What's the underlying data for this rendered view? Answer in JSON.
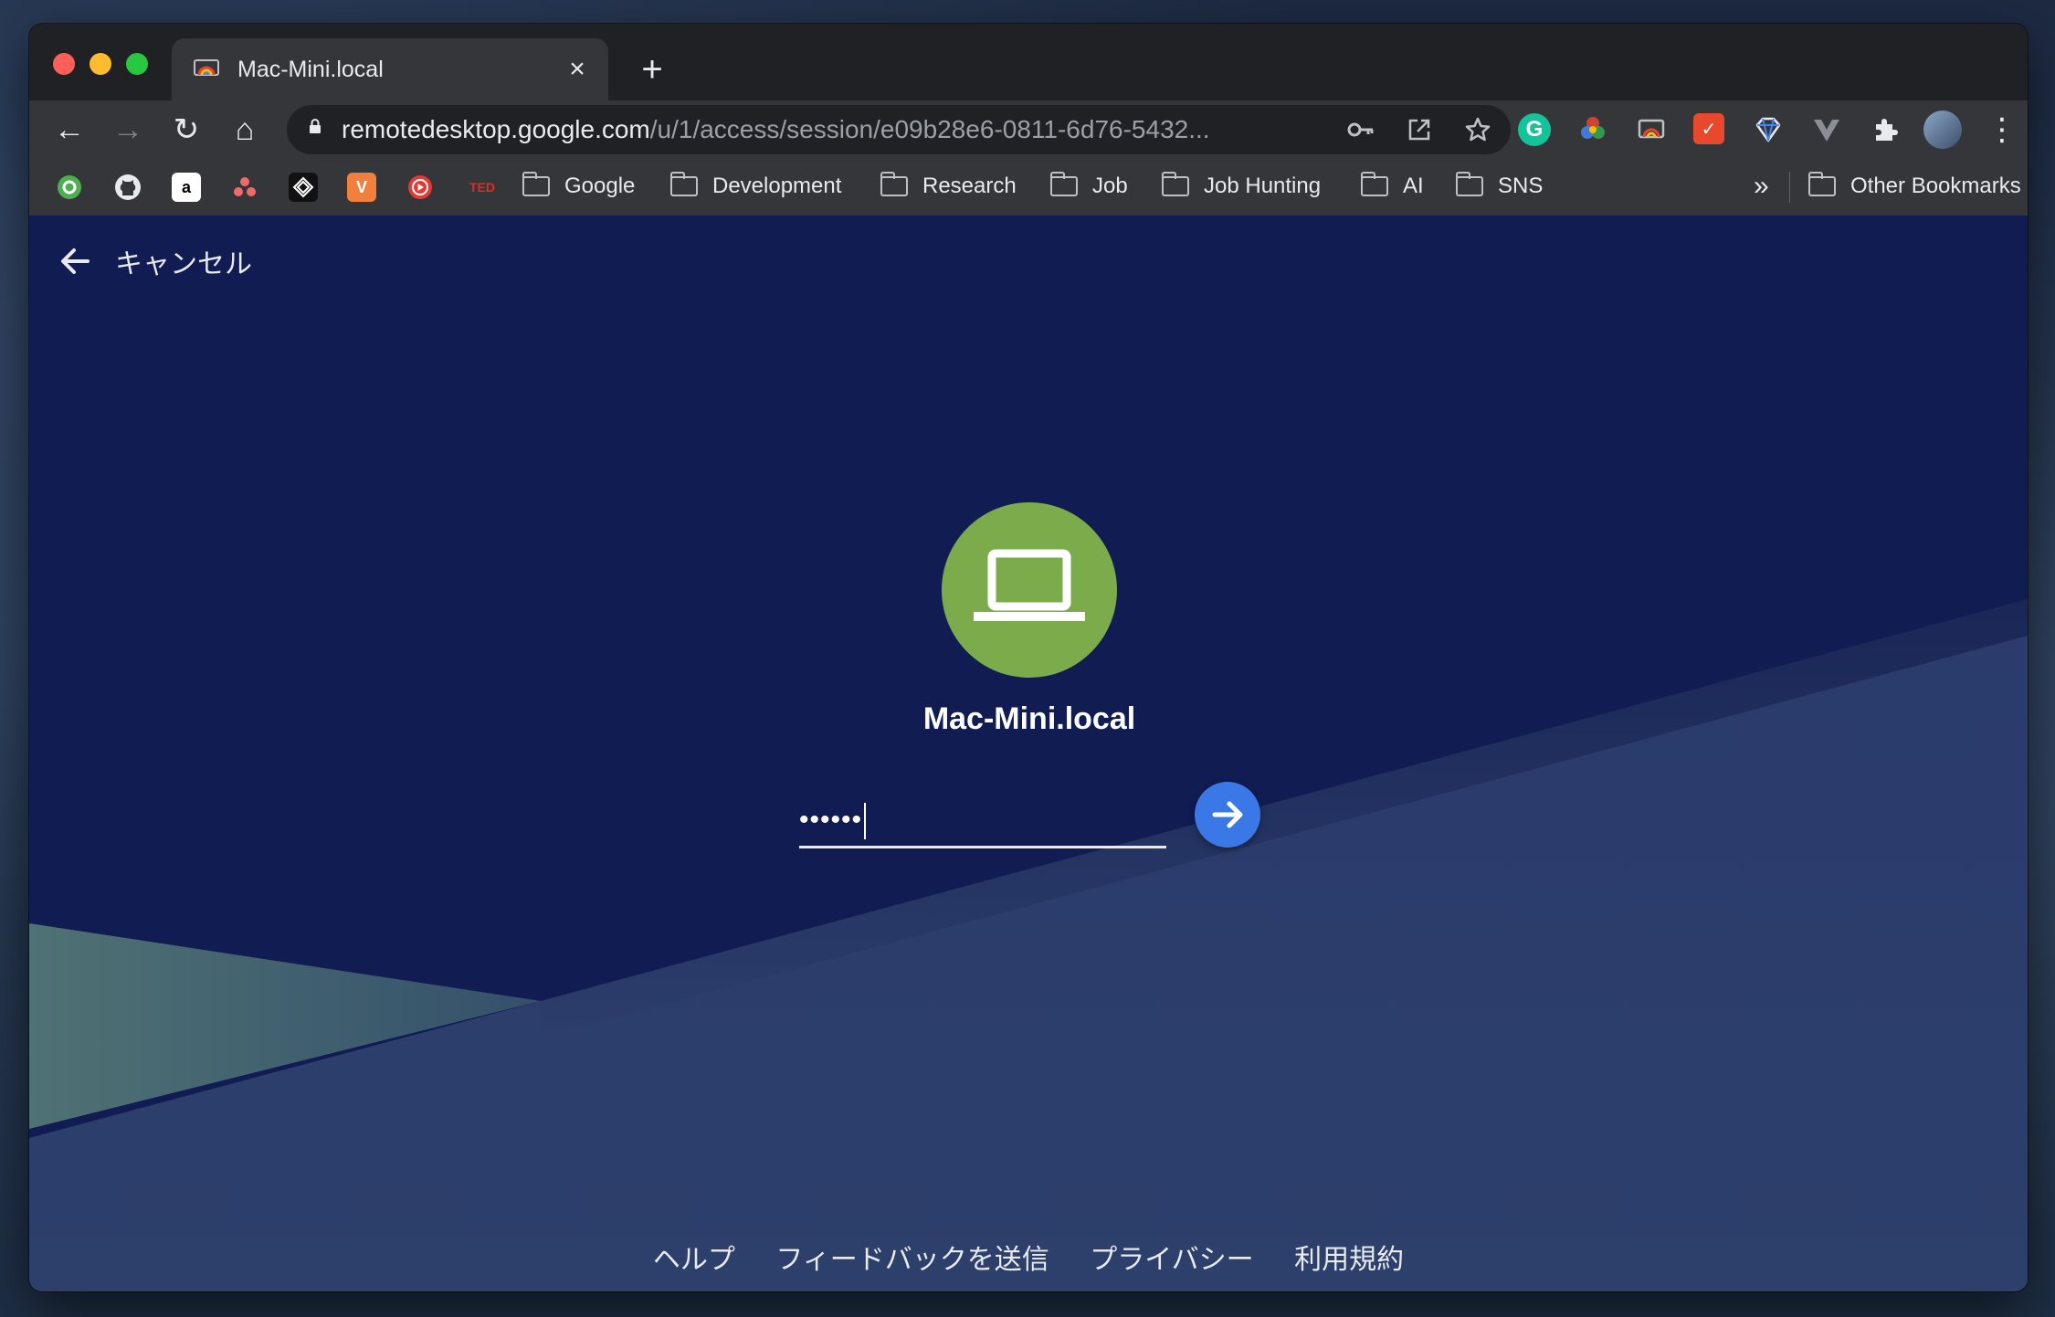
{
  "window": {
    "tab_title": "Mac-Mini.local",
    "tab_close": "×",
    "new_tab": "+"
  },
  "toolbar": {
    "back": "←",
    "forward": "→",
    "reload": "↻",
    "home": "⌂",
    "url_host": "remotedesktop.google.com",
    "url_path": "/u/1/access/session/e09b28e6-0811-6d76-5432...",
    "menu": "⋮"
  },
  "bookmarks": {
    "folders": [
      "Google",
      "Development",
      "Research",
      "Job",
      "Job Hunting",
      "AI",
      "SNS"
    ],
    "overflow": "»",
    "other": "Other Bookmarks",
    "ted_label": "TED"
  },
  "page": {
    "cancel_label": "キャンセル",
    "host_name": "Mac-Mini.local",
    "pin_value": "••••••",
    "footer_links": [
      "ヘルプ",
      "フィードバックを送信",
      "プライバシー",
      "利用規約"
    ]
  },
  "colors": {
    "page_bg": "#101c52",
    "host_avatar": "#7cab4b",
    "submit_button": "#3b78e7"
  }
}
